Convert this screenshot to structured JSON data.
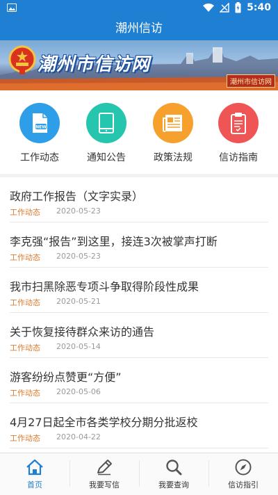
{
  "status_bar": {
    "time": "5:40"
  },
  "app_bar": {
    "title": "潮州信访"
  },
  "banner": {
    "title": "潮州市信访网",
    "stamp": "潮州市信访网"
  },
  "quick_links": [
    {
      "label": "工作动态",
      "icon": "new-document-icon",
      "color": "#2e9ee8"
    },
    {
      "label": "通知公告",
      "icon": "tablet-icon",
      "color": "#25c6ad"
    },
    {
      "label": "政策法规",
      "icon": "newspaper-icon",
      "color": "#f6a02e"
    },
    {
      "label": "信访指南",
      "icon": "clipboard-icon",
      "color": "#f05556"
    }
  ],
  "news": [
    {
      "title": "政府工作报告（文字实录）",
      "category": "工作动态",
      "date": "2020-05-23"
    },
    {
      "title": "李克强“报告”到这里，接连3次被掌声打断",
      "category": "工作动态",
      "date": "2020-05-23"
    },
    {
      "title": "我市扫黑除恶专项斗争取得阶段性成果",
      "category": "工作动态",
      "date": "2020-05-21"
    },
    {
      "title": "关于恢复接待群众来访的通告",
      "category": "工作动态",
      "date": "2020-05-14"
    },
    {
      "title": "游客纷纷点赞更“方便”",
      "category": "工作动态",
      "date": "2020-05-06"
    },
    {
      "title": "4月27日起全市各类学校分期分批返校",
      "category": "工作动态",
      "date": "2020-04-22"
    }
  ],
  "tab_bar": [
    {
      "label": "首页",
      "icon": "home-icon",
      "active": true
    },
    {
      "label": "我要写信",
      "icon": "pencil-icon",
      "active": false
    },
    {
      "label": "我要查询",
      "icon": "search-icon",
      "active": false
    },
    {
      "label": "信访指引",
      "icon": "compass-icon",
      "active": false
    }
  ],
  "colors": {
    "primary": "#1f7fd3",
    "category": "#e07a2c",
    "date": "#999999"
  }
}
